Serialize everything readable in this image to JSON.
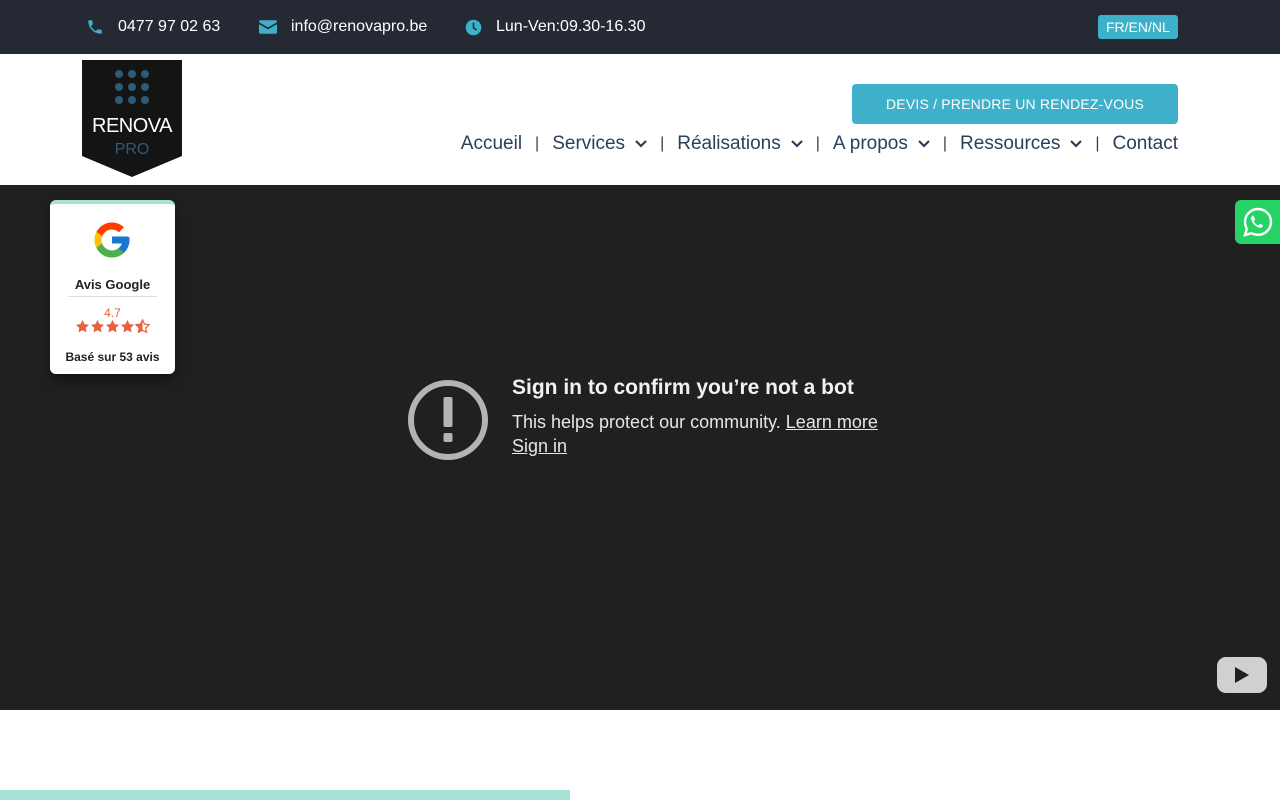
{
  "topbar": {
    "phone": "0477 97 02 63",
    "email": "info@renovapro.be",
    "hours": "Lun-Ven:09.30-16.30",
    "language": "FR/EN/NL"
  },
  "logo": {
    "text_main": "RENOVA",
    "text_sub": "PRO"
  },
  "header": {
    "cta_label": "DEVIS / PRENDRE UN RENDEZ-VOUS"
  },
  "nav": {
    "items": [
      {
        "label": "Accueil"
      },
      {
        "label": "Services"
      },
      {
        "label": "Réalisations"
      },
      {
        "label": "A propos"
      },
      {
        "label": "Ressources"
      },
      {
        "label": "Contact"
      }
    ]
  },
  "video": {
    "title": "Sign in to confirm you’re not a bot",
    "description": "This helps protect our community.",
    "learn_more": "Learn more",
    "sign_in": "Sign in"
  },
  "reviews": {
    "title": "Avis Google",
    "score": "4.7",
    "rating": 4.7,
    "based_on": "Basé sur 53 avis"
  },
  "colors": {
    "topbar_bg": "#252934",
    "accent": "#3eb0c9",
    "nav_text": "#2b4058",
    "video_bg": "#202020",
    "star": "#e7613f",
    "mint": "#a7e2d6",
    "whatsapp": "#25d366"
  },
  "icons": {
    "phone": "phone-icon",
    "email": "envelope-icon",
    "hours": "clock-icon",
    "error": "exclamation-circle-icon",
    "youtube": "youtube-icon",
    "whatsapp": "whatsapp-icon",
    "google": "google-icon"
  }
}
